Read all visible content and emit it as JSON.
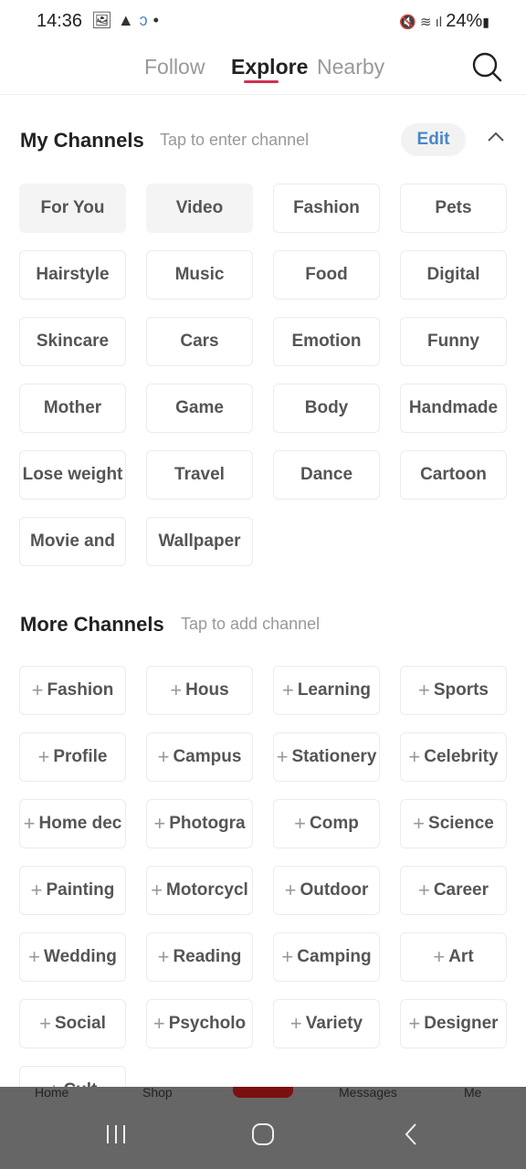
{
  "status": {
    "time": "14:36",
    "left_icons": [
      "image-icon",
      "warning-icon",
      "sync-icon",
      "dot-icon"
    ],
    "battery": "24%",
    "right_icons": [
      "mute-icon",
      "wifi-icon",
      "signal-icon",
      "battery-icon"
    ]
  },
  "tabs": [
    {
      "label": "Follow"
    },
    {
      "label": "Explore",
      "active": true
    },
    {
      "label": "Nearby"
    }
  ],
  "my_channels": {
    "title": "My Channels",
    "hint": "Tap to enter channel",
    "edit_label": "Edit",
    "items": [
      "For You",
      "Video",
      "Fashion",
      "Pets",
      "Hairstyle",
      "Music",
      "Food",
      "Digital",
      "Skincare",
      "Cars",
      "Emotion",
      "Funny",
      "Mother",
      "Game",
      "Body",
      "Handmade",
      "Lose weight",
      "Travel",
      "Dance",
      "Cartoon",
      "Movie and",
      "Wallpaper"
    ]
  },
  "more_channels": {
    "title": "More Channels",
    "hint": "Tap to add channel",
    "items": [
      "Fashion",
      "Hous",
      "Learning",
      "Sports",
      "Profile",
      "Campus",
      "Stationery",
      "Celebrity",
      "Home dec",
      "Photogra",
      "Comp",
      "Science",
      "Painting",
      "Motorcycl",
      "Outdoor",
      "Career",
      "Wedding",
      "Reading",
      "Camping",
      "Art",
      "Social",
      "Psycholo",
      "Variety",
      "Designer",
      "Cult"
    ]
  },
  "bottom_nav": [
    "Home",
    "Shop",
    "Messages",
    "Me"
  ],
  "colors": {
    "accent": "#d03050",
    "edit": "#4a86c8",
    "overlay": "#666666"
  }
}
